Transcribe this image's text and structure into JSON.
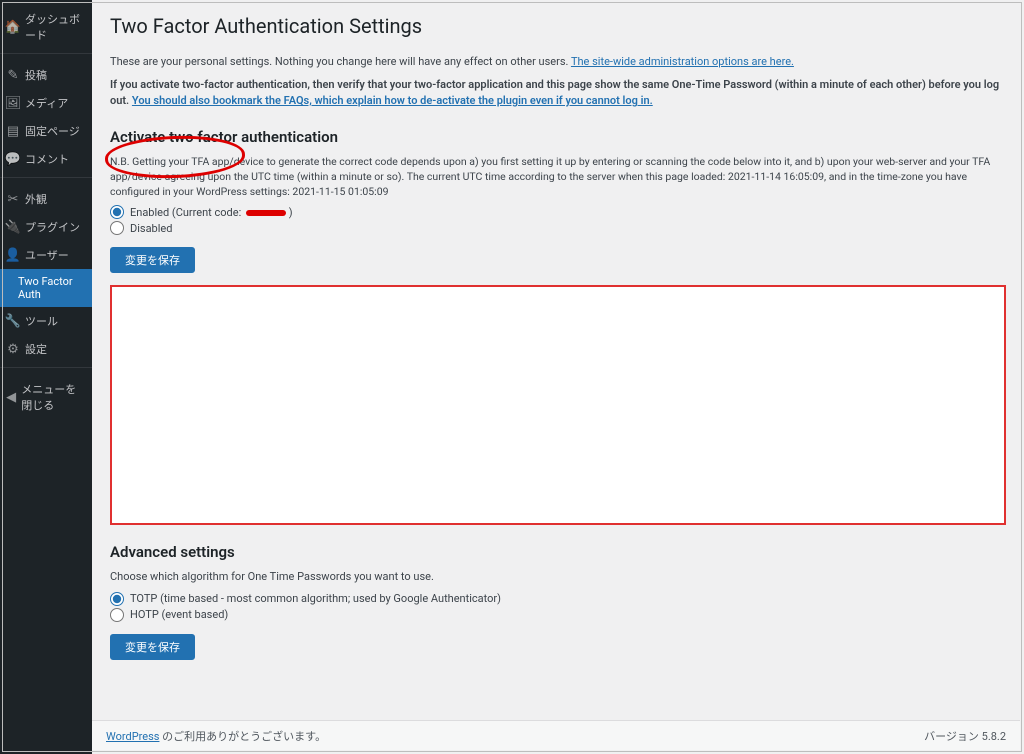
{
  "sidebar": {
    "items": [
      {
        "icon": "🏠",
        "label": "ダッシュボード"
      },
      {
        "icon": "✎",
        "label": "投稿"
      },
      {
        "icon": "🖼",
        "label": "メディア"
      },
      {
        "icon": "▤",
        "label": "固定ページ"
      },
      {
        "icon": "💬",
        "label": "コメント"
      },
      {
        "icon": "✂",
        "label": "外観"
      },
      {
        "icon": "🔌",
        "label": "プラグイン"
      },
      {
        "icon": "👤",
        "label": "ユーザー"
      },
      {
        "icon": "",
        "label": "Two Factor Auth"
      },
      {
        "icon": "🔧",
        "label": "ツール"
      },
      {
        "icon": "⚙",
        "label": "設定"
      },
      {
        "icon": "◀",
        "label": "メニューを閉じる"
      }
    ]
  },
  "page": {
    "title": "Two Factor Authentication Settings",
    "intro_pre": "These are your personal settings. Nothing you change here will have any effect on other users. ",
    "intro_link": "The site-wide administration options are here.",
    "warn_pre": "If you activate two-factor authentication, then verify that your two-factor application and this page show the same One-Time Password (within a minute of each other) before you log out. ",
    "warn_link": "You should also bookmark the FAQs, which explain how to de-activate the plugin even if you cannot log in.",
    "activate_h": "Activate two factor authentication",
    "activate_note": "N.B. Getting your TFA app/device to generate the correct code depends upon a) you first setting it up by entering or scanning the code below into it, and b) upon your web-server and your TFA app/device agreeing upon the UTC time (within a minute or so). The current UTC time according to the server when this page loaded: 2021-11-14 16:05:09, and in the time-zone you have configured in your WordPress settings: 2021-11-15 01:05:09",
    "enable_label": "Enabled (Current code: ",
    "disable_label": "Disabled",
    "save_btn": "変更を保存",
    "adv_h": "Advanced settings",
    "adv_p": "Choose which algorithm for One Time Passwords you want to use.",
    "totp_label": "TOTP (time based - most common algorithm; used by Google Authenticator)",
    "hotp_label": "HOTP (event based)"
  },
  "footer": {
    "wp": "WordPress",
    "thanks": " のご利用ありがとうございます。",
    "version": "バージョン 5.8.2"
  }
}
